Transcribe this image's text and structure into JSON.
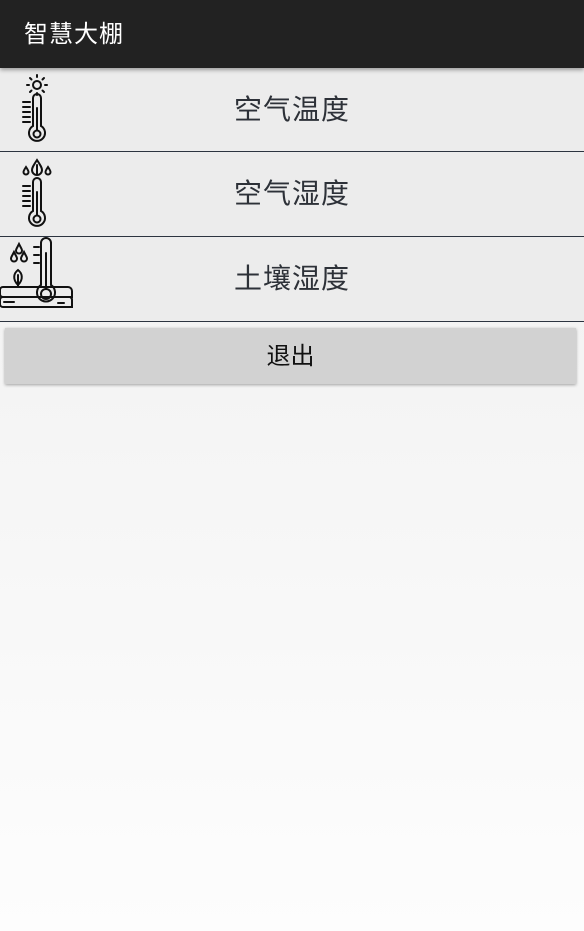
{
  "app": {
    "title": "智慧大棚"
  },
  "menu": {
    "items": [
      {
        "label": "空气温度",
        "icon": "air-temperature-thermometer-icon"
      },
      {
        "label": "空气湿度",
        "icon": "air-humidity-thermometer-icon"
      },
      {
        "label": "土壤湿度",
        "icon": "soil-moisture-thermometer-icon"
      }
    ]
  },
  "actions": {
    "exit_label": "退出"
  },
  "colors": {
    "appbar_bg": "#222222",
    "row_bg": "#ececec",
    "divider": "#2c3440",
    "button_bg": "#d2d2d2"
  }
}
